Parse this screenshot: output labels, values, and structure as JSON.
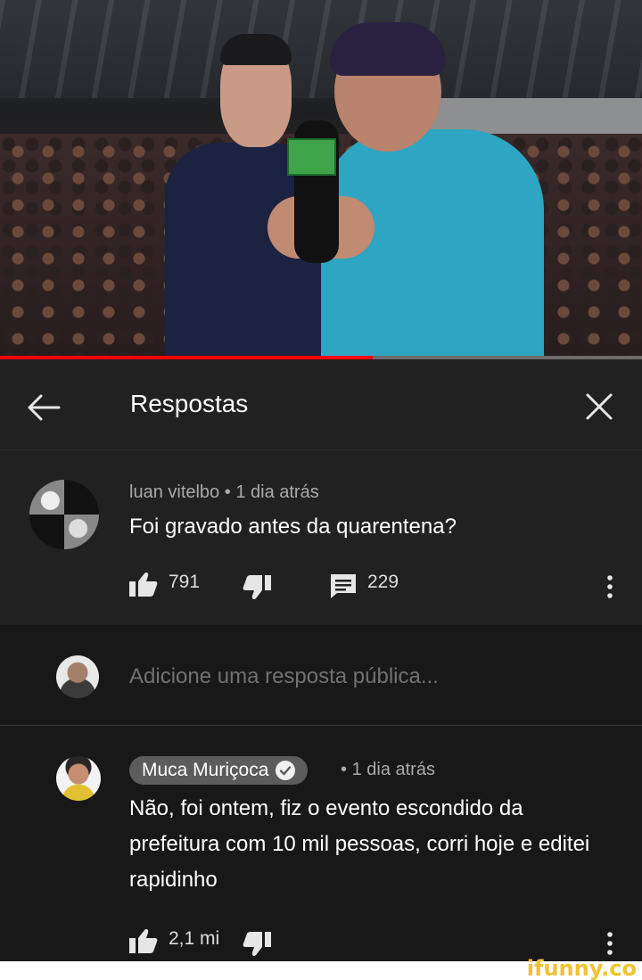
{
  "video": {
    "progress_percent": 58
  },
  "header": {
    "title": "Respostas"
  },
  "comment": {
    "author": "luan vitelbo",
    "time": "1 dia atrás",
    "separator": "•",
    "text": "Foi gravado antes da quarentena?",
    "likes": "791",
    "replies": "229"
  },
  "add_reply": {
    "placeholder": "Adicione uma resposta pública..."
  },
  "reply": {
    "author": "Muca Muriçoca",
    "separator": "•",
    "time": "1 dia atrás",
    "text": "Não, foi ontem, fiz o evento escondido da prefeitura com 10 mil pessoas, corri hoje e editei rapidinho",
    "likes": "2,1 mi"
  },
  "watermark": {
    "text": "ifunny.co"
  },
  "colors": {
    "background": "#181818",
    "panel": "#212121",
    "progress": "#ff0000",
    "watermark": "#f2c230"
  },
  "icons": [
    "back-arrow-icon",
    "close-icon",
    "thumbs-up-icon",
    "thumbs-down-icon",
    "reply-comment-icon",
    "more-vertical-icon",
    "verified-check-icon"
  ]
}
